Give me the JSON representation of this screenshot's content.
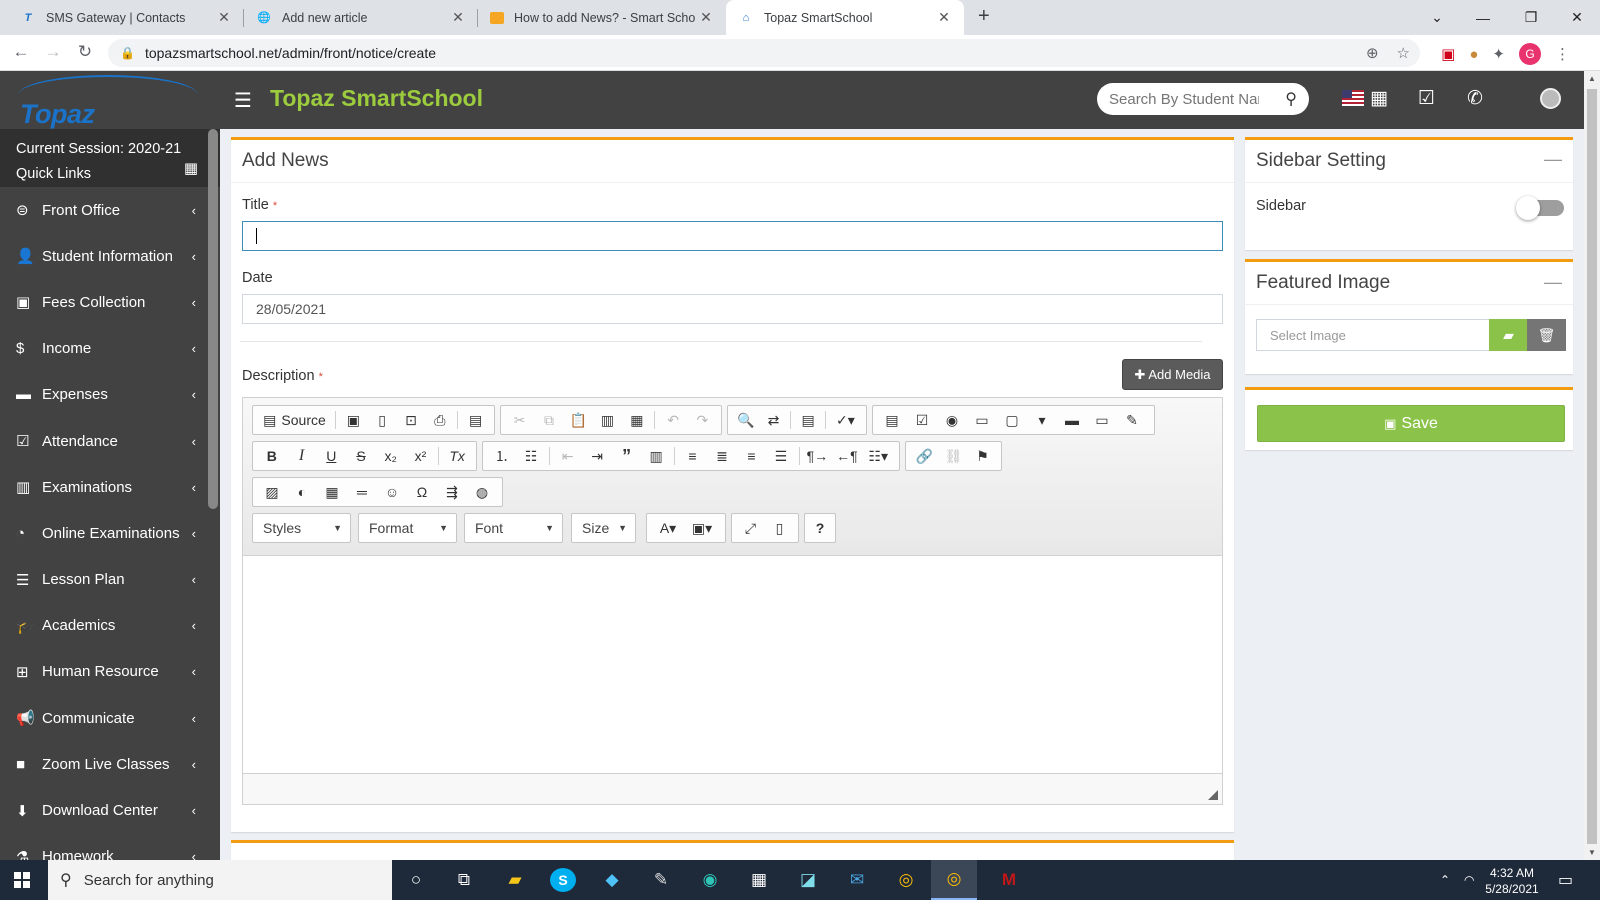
{
  "browser": {
    "tabs": [
      {
        "title": "SMS Gateway | Contacts",
        "active": false
      },
      {
        "title": "Add new article",
        "active": false
      },
      {
        "title": "How to add News? - Smart Scho",
        "active": false
      },
      {
        "title": "Topaz SmartSchool",
        "active": true
      }
    ],
    "url": "topazsmartschool.net/admin/front/notice/create",
    "profile_initial": "G"
  },
  "app": {
    "logo_text": "Topaz SmartSchool",
    "title": "Topaz SmartSchool",
    "search_placeholder": "Search By Student Name"
  },
  "sidebar": {
    "session": "Current Session: 2020-21",
    "quick_links": "Quick Links",
    "items": [
      {
        "label": "Front Office",
        "icon": "desk-icon"
      },
      {
        "label": "Student Information",
        "icon": "user-icon"
      },
      {
        "label": "Fees Collection",
        "icon": "money-icon"
      },
      {
        "label": "Income",
        "icon": "dollar-icon"
      },
      {
        "label": "Expenses",
        "icon": "card-icon"
      },
      {
        "label": "Attendance",
        "icon": "calendar-check-icon"
      },
      {
        "label": "Examinations",
        "icon": "map-icon"
      },
      {
        "label": "Online Examinations",
        "icon": "rss-icon"
      },
      {
        "label": "Lesson Plan",
        "icon": "list-icon"
      },
      {
        "label": "Academics",
        "icon": "graduation-cap-icon"
      },
      {
        "label": "Human Resource",
        "icon": "sitemap-icon"
      },
      {
        "label": "Communicate",
        "icon": "bullhorn-icon"
      },
      {
        "label": "Zoom Live Classes",
        "icon": "video-icon"
      },
      {
        "label": "Download Center",
        "icon": "download-icon"
      },
      {
        "label": "Homework",
        "icon": "flask-icon"
      }
    ]
  },
  "form": {
    "heading": "Add News",
    "title_label": "Title",
    "title_value": "",
    "date_label": "Date",
    "date_value": "28/05/2021",
    "description_label": "Description",
    "add_media_label": "Add Media",
    "required_mark": "*"
  },
  "editor": {
    "source_label": "Source",
    "styles_label": "Styles",
    "format_label": "Format",
    "font_label": "Font",
    "size_label": "Size"
  },
  "sidebar_setting": {
    "heading": "Sidebar Setting",
    "toggle_label": "Sidebar",
    "toggle_on": false
  },
  "featured_image": {
    "heading": "Featured Image",
    "placeholder": "Select Image"
  },
  "save_label": "Save",
  "taskbar": {
    "search_text": "Search for anything",
    "time": "4:32 AM",
    "date": "5/28/2021"
  }
}
